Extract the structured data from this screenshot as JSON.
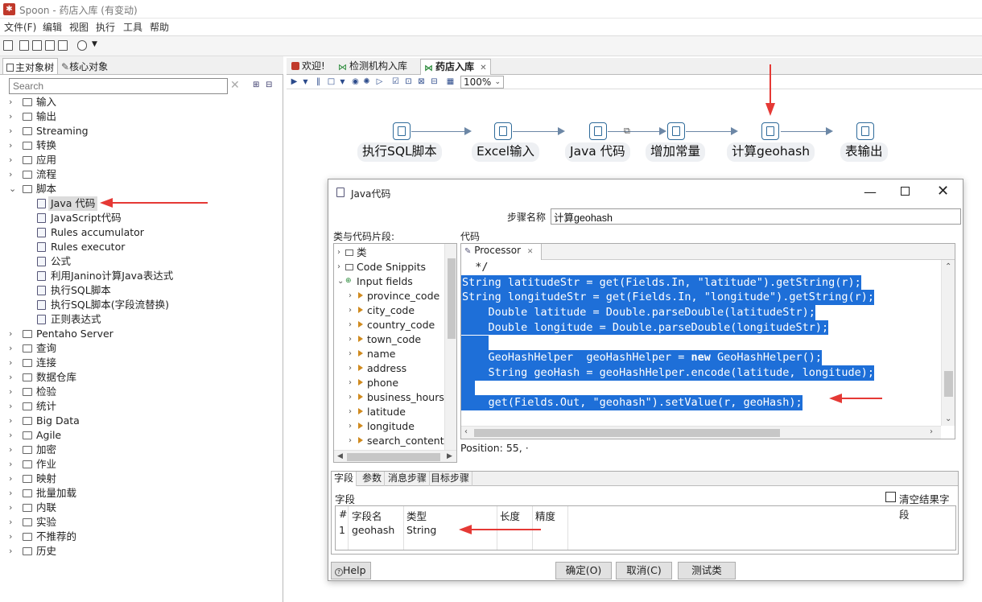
{
  "window": {
    "title": "Spoon - 药店入库 (有变动)"
  },
  "menu": [
    "文件(F)",
    "编辑",
    "视图",
    "执行",
    "工具",
    "帮助"
  ],
  "left_panel": {
    "tabs": [
      "主对象树",
      "核心对象"
    ],
    "search_placeholder": "Search",
    "tree": [
      {
        "label": "输入",
        "expanded": false
      },
      {
        "label": "输出",
        "expanded": false
      },
      {
        "label": "Streaming",
        "expanded": false
      },
      {
        "label": "转换",
        "expanded": false
      },
      {
        "label": "应用",
        "expanded": false
      },
      {
        "label": "流程",
        "expanded": false
      },
      {
        "label": "脚本",
        "expanded": true
      },
      {
        "label": "Pentaho Server",
        "expanded": false
      },
      {
        "label": "查询",
        "expanded": false
      },
      {
        "label": "连接",
        "expanded": false
      },
      {
        "label": "数据仓库",
        "expanded": false
      },
      {
        "label": "检验",
        "expanded": false
      },
      {
        "label": "统计",
        "expanded": false
      },
      {
        "label": "Big Data",
        "expanded": false
      },
      {
        "label": "Agile",
        "expanded": false
      },
      {
        "label": "加密",
        "expanded": false
      },
      {
        "label": "作业",
        "expanded": false
      },
      {
        "label": "映射",
        "expanded": false
      },
      {
        "label": "批量加载",
        "expanded": false
      },
      {
        "label": "内联",
        "expanded": false
      },
      {
        "label": "实验",
        "expanded": false
      },
      {
        "label": "不推荐的",
        "expanded": false
      },
      {
        "label": "历史",
        "expanded": false
      }
    ],
    "script_children": [
      {
        "label": "Java 代码",
        "icon": "java-code-icon",
        "selected": true
      },
      {
        "label": "JavaScript代码",
        "icon": "javascript-icon"
      },
      {
        "label": "Rules accumulator",
        "icon": "rules-icon"
      },
      {
        "label": "Rules executor",
        "icon": "rules-icon"
      },
      {
        "label": "公式",
        "icon": "formula-icon"
      },
      {
        "label": "利用Janino计算Java表达式",
        "icon": "janino-icon"
      },
      {
        "label": "执行SQL脚本",
        "icon": "sql-script-icon"
      },
      {
        "label": "执行SQL脚本(字段流替换)",
        "icon": "sql-script-icon"
      },
      {
        "label": "正则表达式",
        "icon": "regex-icon"
      }
    ]
  },
  "editor_tabs": [
    {
      "label": "欢迎!",
      "icon": "welcome-icon"
    },
    {
      "label": "检测机构入库",
      "icon": "transformation-icon"
    },
    {
      "label": "药店入库",
      "icon": "transformation-icon",
      "active": true
    }
  ],
  "canvas_toolbar": {
    "zoom": "100%"
  },
  "flow": {
    "steps": [
      {
        "label": "执行SQL脚本"
      },
      {
        "label": "Excel输入"
      },
      {
        "label": "Java 代码"
      },
      {
        "label": "增加常量"
      },
      {
        "label": "计算geohash"
      },
      {
        "label": "表输出"
      }
    ]
  },
  "dialog": {
    "title": "Java代码",
    "step_name_label": "步骤名称",
    "step_name_value": "计算geohash",
    "snippets_label": "类与代码片段:",
    "code_label": "代码",
    "snippets": [
      {
        "label": "类",
        "type": "folder",
        "level": 0
      },
      {
        "label": "Code Snippits",
        "type": "folder",
        "level": 0
      },
      {
        "label": "Input fields",
        "type": "fields",
        "level": 0,
        "expanded": true
      },
      {
        "label": "province_code",
        "level": 1
      },
      {
        "label": "city_code",
        "level": 1
      },
      {
        "label": "country_code",
        "level": 1
      },
      {
        "label": "town_code",
        "level": 1
      },
      {
        "label": "name",
        "level": 1
      },
      {
        "label": "address",
        "level": 1
      },
      {
        "label": "phone",
        "level": 1
      },
      {
        "label": "business_hours",
        "level": 1
      },
      {
        "label": "latitude",
        "level": 1
      },
      {
        "label": "longitude",
        "level": 1
      },
      {
        "label": "search_content",
        "level": 1
      }
    ],
    "code_tab": "Processor",
    "code_lines": [
      {
        "text": "  */",
        "selected": false
      },
      {
        "text": "String latitudeStr = get(Fields.In, \"latitude\").getString(r);",
        "selected": true
      },
      {
        "text": "String longitudeStr = get(Fields.In, \"longitude\").getString(r);",
        "selected": true
      },
      {
        "text": "    Double latitude = Double.parseDouble(latitudeStr);",
        "selected": true
      },
      {
        "text": "    Double longitude = Double.parseDouble(longitudeStr);",
        "selected": true
      },
      {
        "text": "    ",
        "selected": true
      },
      {
        "text": "    GeoHashHelper  geoHashHelper = new GeoHashHelper();",
        "selected": true
      },
      {
        "text": "    String geoHash = geoHashHelper.encode(latitude, longitude);",
        "selected": true
      },
      {
        "text": "  ",
        "selected": true
      },
      {
        "text": "    get(Fields.Out, \"geohash\").setValue(r, geoHash);",
        "selected": true
      }
    ],
    "position": "Position: 55, ·",
    "bottom_tabs": [
      "字段",
      "参数",
      "消息步骤",
      "目标步骤"
    ],
    "fields_label": "字段",
    "clear_fields_label": "清空结果字段",
    "table": {
      "headers": [
        "#",
        "字段名",
        "类型",
        "长度",
        "精度"
      ],
      "rows": [
        [
          "1",
          "geohash",
          "String",
          "",
          ""
        ]
      ]
    },
    "buttons": {
      "help": "Help",
      "ok": "确定(O)",
      "cancel": "取消(C)",
      "test": "测试类"
    }
  }
}
